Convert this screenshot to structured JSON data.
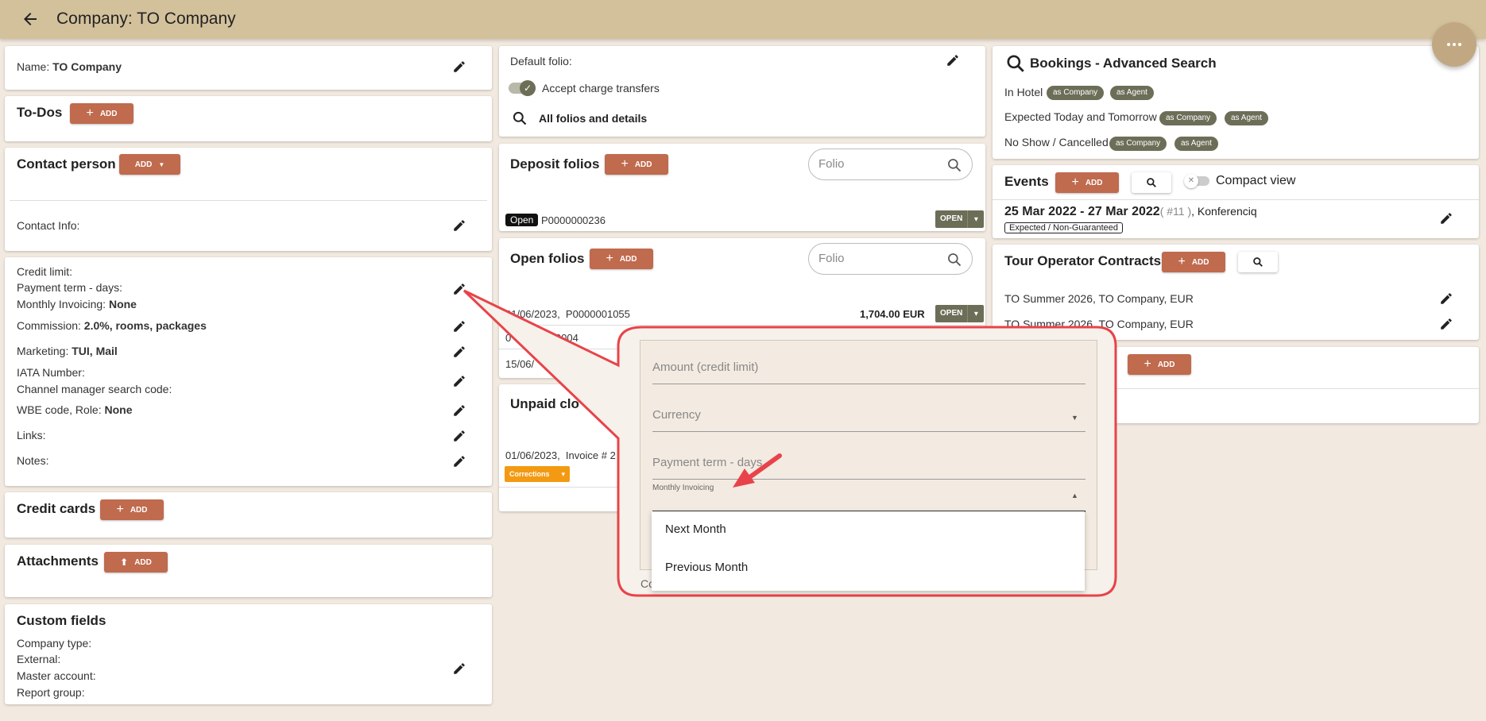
{
  "header": {
    "title": "Company: TO Company"
  },
  "left": {
    "name": {
      "label": "Name:",
      "value": "TO Company"
    },
    "todos": {
      "title": "To-Dos",
      "add": "ADD"
    },
    "contact": {
      "title": "Contact person",
      "add": "ADD",
      "info_label": "Contact Info:"
    },
    "details": {
      "credit_limit": "Credit limit:",
      "payment_term": "Payment term - days:",
      "monthly_invoicing": {
        "label": "Monthly Invoicing:",
        "value": "None"
      },
      "commission": {
        "label": "Commission:",
        "value": "2.0%, rooms, packages"
      },
      "marketing": {
        "label": "Marketing:",
        "value": "TUI, Mail"
      },
      "iata": "IATA Number:",
      "channel_manager": "Channel manager search code:",
      "wbe": {
        "label": "WBE code, Role:",
        "value": "None"
      },
      "links": "Links:",
      "notes": "Notes:"
    },
    "credit_cards": {
      "title": "Credit cards",
      "add": "ADD"
    },
    "attachments": {
      "title": "Attachments",
      "add": "ADD"
    },
    "custom_fields": {
      "title": "Custom fields",
      "company_type": "Company type:",
      "external": "External:",
      "master_account": "Master account:",
      "report_group": "Report group:"
    }
  },
  "middle": {
    "default_folio": "Default folio:",
    "accept_charge": "Accept charge transfers",
    "all_folios": "All folios and details",
    "deposit": {
      "title": "Deposit folios",
      "add": "ADD",
      "search_placeholder": "Folio",
      "rows": [
        {
          "status": "Open",
          "number": "P0000000236",
          "action": "OPEN"
        }
      ]
    },
    "open": {
      "title": "Open folios",
      "add": "ADD",
      "search_placeholder": "Folio",
      "rows": [
        {
          "date": "01/06/2023,",
          "number": "P0000001055",
          "amount": "1,704.00 EUR",
          "action": "OPEN"
        },
        {
          "date": "0",
          "number": "P00000004"
        },
        {
          "date": "15/06/"
        }
      ]
    },
    "unpaid": {
      "title": "Unpaid clo",
      "row": {
        "date": "01/06/2023,",
        "text": "Invoice  # 2",
        "corrections": "Corrections"
      }
    }
  },
  "right": {
    "bookings": {
      "title": "Bookings - Advanced Search",
      "rows": [
        {
          "label": "In Hotel",
          "company": "as Company",
          "agent": "as Agent"
        },
        {
          "label": "Expected Today and Tomorrow",
          "company": "as Company",
          "agent": "as Agent"
        },
        {
          "label": "No Show / Cancelled",
          "company": "as Company",
          "agent": "as Agent"
        }
      ]
    },
    "events": {
      "title": "Events",
      "add": "ADD",
      "compact": "Compact view",
      "item": {
        "dates": "25 Mar 2022 - 27 Mar 2022",
        "num": "( #11 )",
        "name": ", Konferenciq",
        "status": "Expected / Non-Guaranteed"
      }
    },
    "contracts": {
      "title": "Tour Operator Contracts",
      "add": "ADD",
      "rows": [
        "TO Summer 2026, TO Company, EUR",
        "TO Summer 2026, TO Company, EUR"
      ]
    },
    "extra": {
      "add": "ADD"
    }
  },
  "popup": {
    "amount_label": "Amount (credit limit)",
    "currency_label": "Currency",
    "payment_term_label": "Payment term - days",
    "monthly_label": "Monthly Invoicing",
    "options": [
      "Next Month",
      "Previous Month"
    ],
    "cut_text": "Co"
  },
  "colors": {
    "topbar": "#d3c19c",
    "accent": "#c06a4e",
    "pill": "#6d6e58",
    "callout": "#e8434a"
  }
}
